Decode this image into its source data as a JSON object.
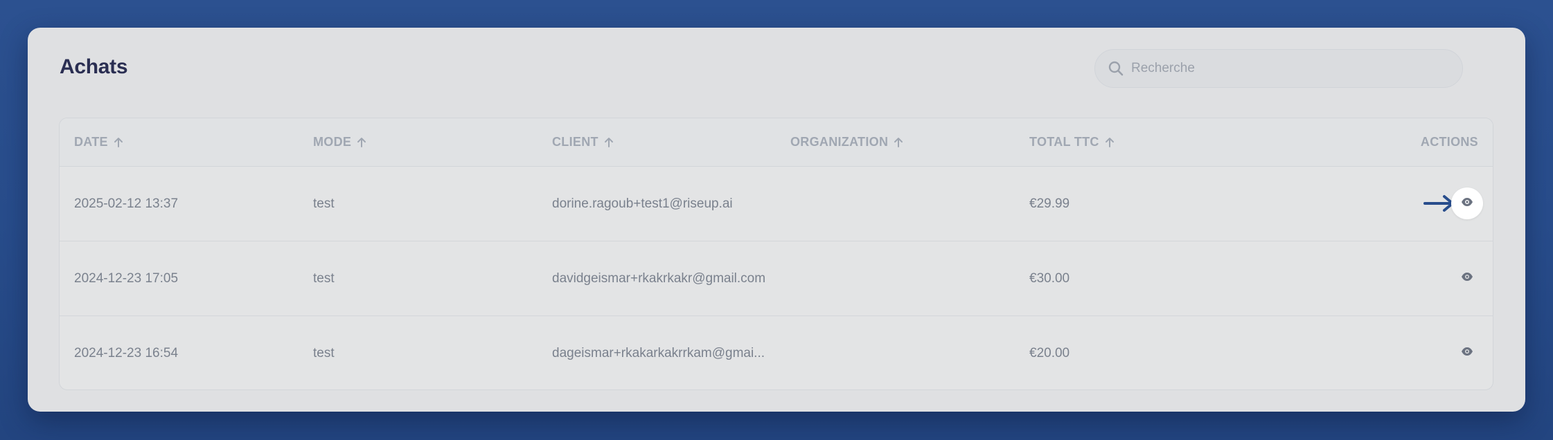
{
  "page": {
    "title": "Achats"
  },
  "search": {
    "placeholder": "Recherche",
    "value": "",
    "icon": "search-icon"
  },
  "table": {
    "columns": [
      {
        "label": "DATE",
        "sort": "asc"
      },
      {
        "label": "MODE",
        "sort": "asc"
      },
      {
        "label": "CLIENT",
        "sort": "asc"
      },
      {
        "label": "ORGANIZATION",
        "sort": "asc"
      },
      {
        "label": "TOTAL TTC",
        "sort": "asc"
      },
      {
        "label": "ACTIONS"
      }
    ],
    "rows": [
      {
        "date": "2025-02-12 13:37",
        "mode": "test",
        "client": "dorine.ragoub+test1@riseup.ai",
        "organization": "",
        "total": "€29.99",
        "action_icon": "eye-icon",
        "highlighted": true
      },
      {
        "date": "2024-12-23 17:05",
        "mode": "test",
        "client": "davidgeismar+rkakrkakr@gmail.com",
        "organization": "",
        "total": "€30.00",
        "action_icon": "eye-icon",
        "highlighted": false
      },
      {
        "date": "2024-12-23 16:54",
        "mode": "test",
        "client": "dageismar+rkakarkakrrkam@gmai...",
        "organization": "",
        "total": "€20.00",
        "action_icon": "eye-icon",
        "highlighted": false
      }
    ]
  },
  "annotation": {
    "icon": "arrow-right-icon",
    "color": "#284d8c"
  },
  "colors": {
    "background": "#2a4f8e",
    "card": "#dfe0e2",
    "title": "#2a2e52",
    "header_text": "#a0a7b2",
    "cell_text": "#7a818d",
    "eye_icon": "#6b7280"
  }
}
